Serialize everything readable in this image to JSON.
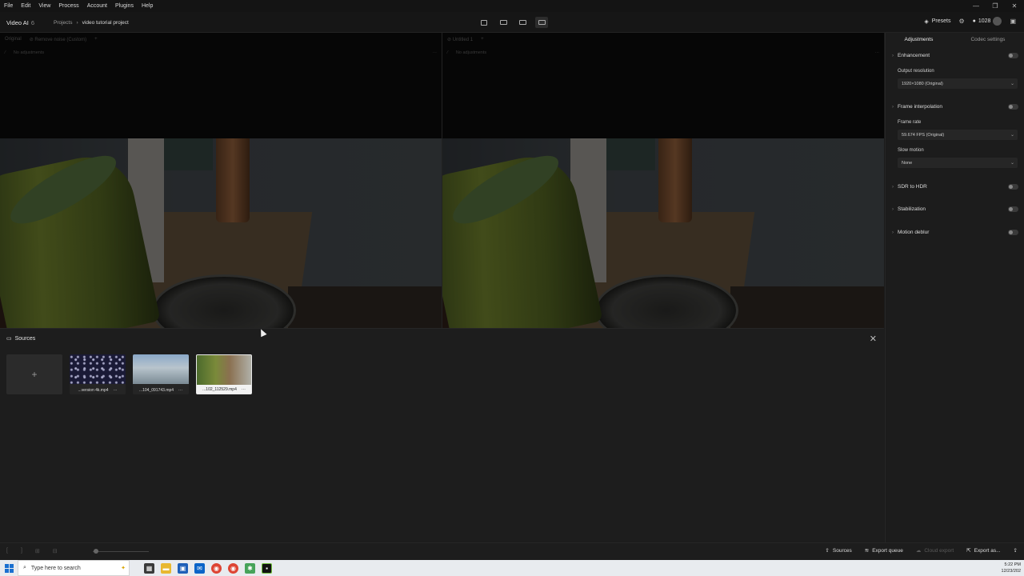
{
  "menu": [
    "File",
    "Edit",
    "View",
    "Process",
    "Account",
    "Plugins",
    "Help"
  ],
  "title": {
    "app": "Video AI",
    "version": "6"
  },
  "breadcrumb": {
    "root": "Projects",
    "current": "video tutorial project"
  },
  "header": {
    "presets": "Presets",
    "credits": "1028"
  },
  "preview": {
    "left_tabs": [
      "Original",
      "Remove noise (Custom)"
    ],
    "left_sub": "No adjustments",
    "right_tabs": [
      "Untitled 1"
    ],
    "right_sub": "No adjustments"
  },
  "sources": {
    "title": "Sources",
    "add_label": "+",
    "items": [
      {
        "name": "...version 4k.mp4"
      },
      {
        "name": "...104_091743.mp4"
      },
      {
        "name": "...102_112529.mp4"
      }
    ],
    "more": "···"
  },
  "bottombar": {
    "sources": "Sources",
    "export_queue": "Export queue",
    "cloud_export": "Cloud export",
    "export_as": "Export as..."
  },
  "panel": {
    "tabs": [
      "Adjustments",
      "Codec settings"
    ],
    "enhancement": "Enhancement",
    "output_resolution_label": "Output resolution",
    "output_resolution": "1920×1080 (Original)",
    "frame_interpolation": "Frame interpolation",
    "frame_rate_label": "Frame rate",
    "frame_rate": "59.674 FPS (Original)",
    "slow_motion_label": "Slow motion",
    "slow_motion": "None",
    "sdr_to_hdr": "SDR to HDR",
    "stabilization": "Stabilization",
    "motion_deblur": "Motion deblur"
  },
  "taskbar": {
    "search_placeholder": "Type here to search",
    "time": "5:22 PM",
    "date": "12/23/202"
  }
}
